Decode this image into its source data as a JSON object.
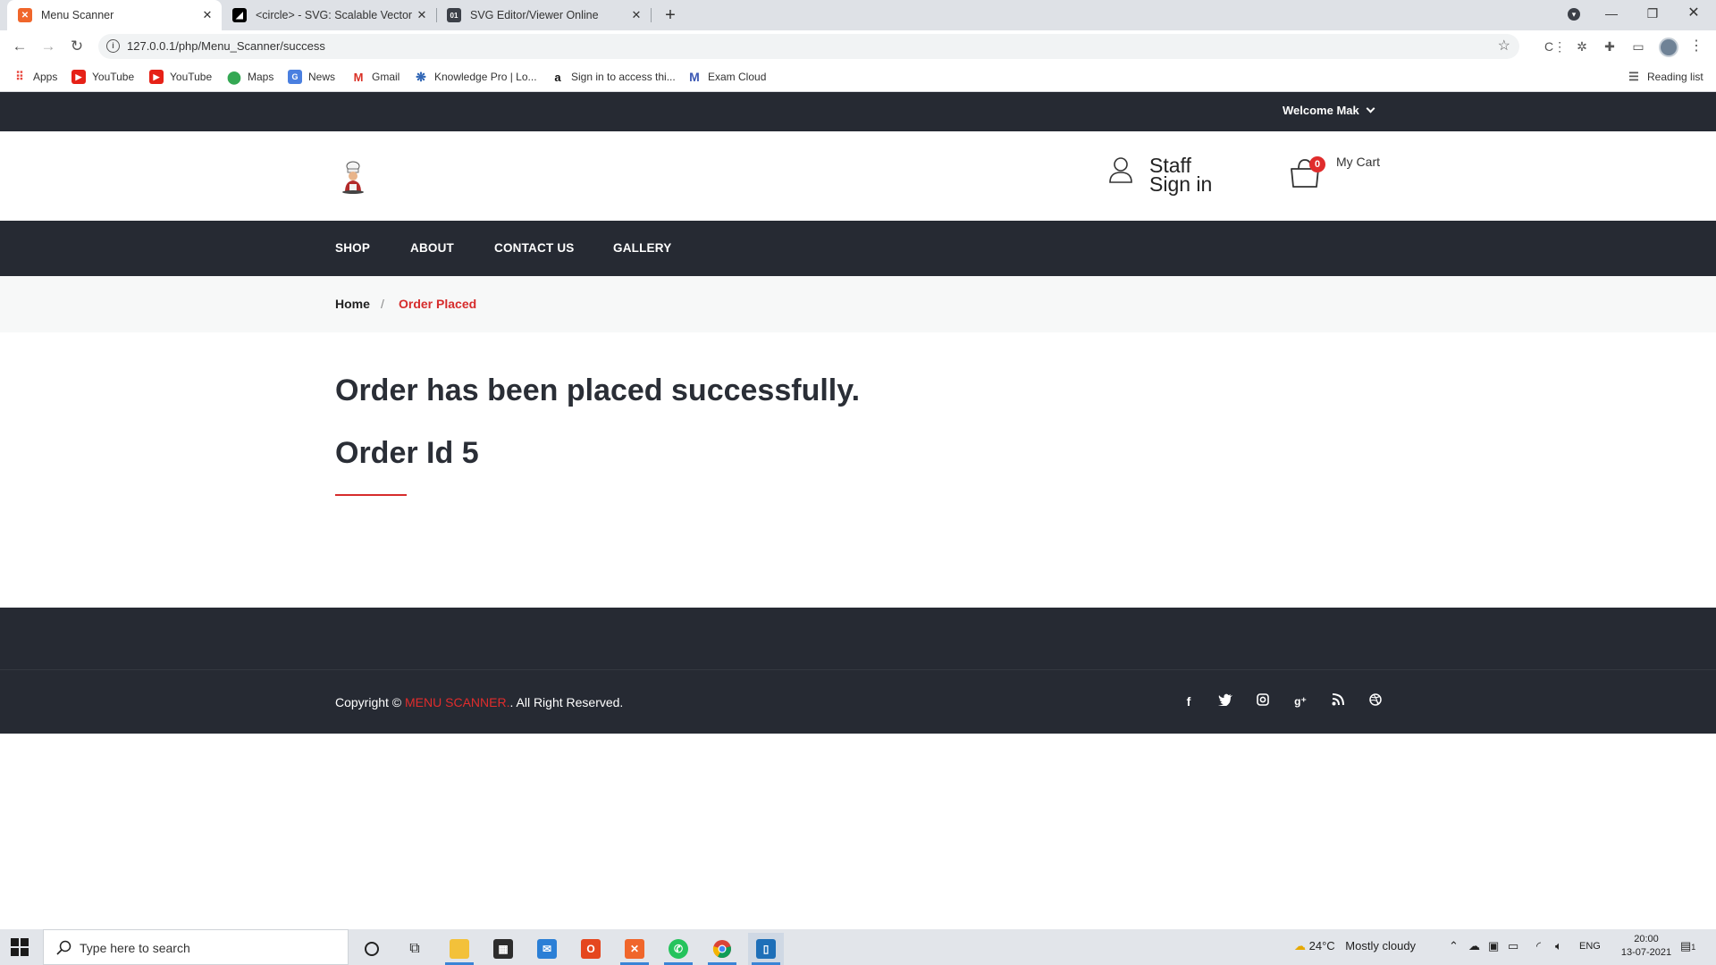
{
  "browser": {
    "tabs": [
      {
        "title": "Menu Scanner",
        "active": true,
        "icon": "xampp-icon"
      },
      {
        "title": "<circle> - SVG: Scalable Vector Graphics",
        "active": false,
        "icon": "mdn-icon"
      },
      {
        "title": "SVG Editor/Viewer Online",
        "active": false,
        "icon": "svg-editor-icon"
      }
    ],
    "url": "127.0.0.1/php/Menu_Scanner/success",
    "bookmarks": [
      {
        "label": "Apps",
        "icon": "apps-grid-icon"
      },
      {
        "label": "YouTube",
        "icon": "youtube-icon"
      },
      {
        "label": "YouTube",
        "icon": "youtube-icon"
      },
      {
        "label": "Maps",
        "icon": "maps-pin-icon"
      },
      {
        "label": "News",
        "icon": "news-icon"
      },
      {
        "label": "Gmail",
        "icon": "gmail-icon"
      },
      {
        "label": "Knowledge Pro | Lo...",
        "icon": "knowledge-pro-icon"
      },
      {
        "label": "Sign in to access thi...",
        "icon": "amazon-icon"
      },
      {
        "label": "Exam Cloud",
        "icon": "exam-cloud-icon"
      }
    ],
    "reading_list": "Reading list"
  },
  "site": {
    "welcome": "Welcome Mak",
    "staff_line1": "Staff",
    "staff_line2": "Sign in",
    "cart_count": "0",
    "cart_label": "My Cart",
    "nav": [
      "SHOP",
      "ABOUT",
      "CONTACT US",
      "GALLERY"
    ],
    "breadcrumb": {
      "home": "Home",
      "separator": "/",
      "current": "Order Placed"
    },
    "message": "Order has been placed successfully.",
    "order_id": "Order Id 5",
    "footer": {
      "copyright_prefix": "Copyright ©",
      "brand": "MENU SCANNER.",
      "copyright_suffix": ". All Right Reserved.",
      "social": [
        "facebook-icon",
        "twitter-icon",
        "instagram-icon",
        "google-plus-icon",
        "rss-icon",
        "dribbble-icon"
      ]
    },
    "colors": {
      "dark": "#262a33",
      "accent": "#d62c2c"
    }
  },
  "taskbar": {
    "search_placeholder": "Type here to search",
    "weather_temp": "24°C",
    "weather_text": "Mostly cloudy",
    "language": "ENG",
    "time": "20:00",
    "date": "13-07-2021",
    "notification_count": "1"
  }
}
